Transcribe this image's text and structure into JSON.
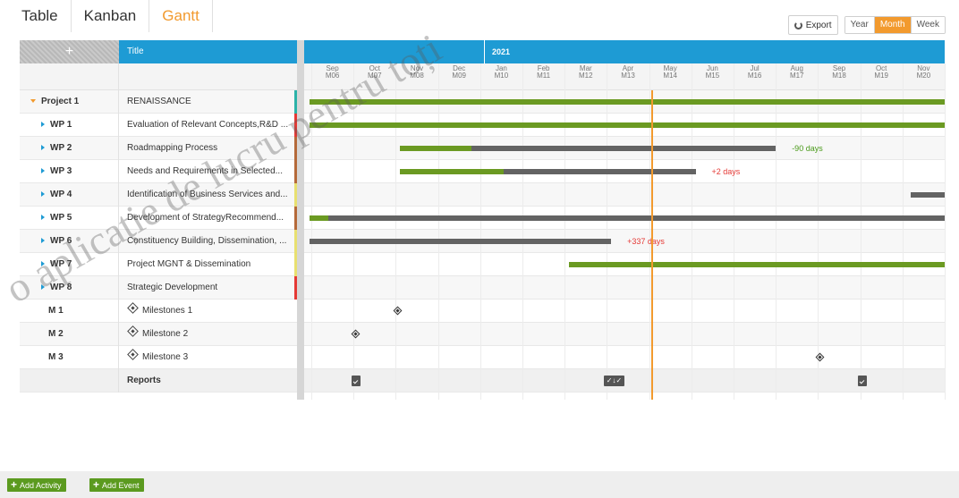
{
  "view_tabs": [
    {
      "label": "Table"
    },
    {
      "label": "Kanban"
    },
    {
      "label": "Gantt",
      "active": true
    }
  ],
  "toolbar": {
    "export_label": "Export",
    "zoom": [
      {
        "label": "Year"
      },
      {
        "label": "Month",
        "active": true
      },
      {
        "label": "Week"
      }
    ]
  },
  "header": {
    "add_symbol": "+",
    "title_label": "Title",
    "year_label": "2021",
    "months": [
      {
        "name": "Sep",
        "code": "M06"
      },
      {
        "name": "Oct",
        "code": "M07"
      },
      {
        "name": "Nov",
        "code": "M08"
      },
      {
        "name": "Dec",
        "code": "M09"
      },
      {
        "name": "Jan",
        "code": "M10"
      },
      {
        "name": "Feb",
        "code": "M11"
      },
      {
        "name": "Mar",
        "code": "M12"
      },
      {
        "name": "Apr",
        "code": "M13"
      },
      {
        "name": "May",
        "code": "M14"
      },
      {
        "name": "Jun",
        "code": "M15"
      },
      {
        "name": "Jul",
        "code": "M16"
      },
      {
        "name": "Aug",
        "code": "M17"
      },
      {
        "name": "Sep",
        "code": "M18"
      },
      {
        "name": "Oct",
        "code": "M19"
      },
      {
        "name": "Nov",
        "code": "M20"
      }
    ]
  },
  "rows": [
    {
      "id": "Project 1",
      "title": "RENAISSANCE",
      "kind": "project",
      "status_color": "#2bb3a8"
    },
    {
      "id": "WP 1",
      "title": "Evaluation of Relevant Concepts,R&D ...",
      "kind": "wp",
      "status_color": "#e53935"
    },
    {
      "id": "WP 2",
      "title": "Roadmapping Process",
      "kind": "wp",
      "status_color": "#b56a3a"
    },
    {
      "id": "WP 3",
      "title": "Needs and Requirements in Selected...",
      "kind": "wp",
      "status_color": "#b56a3a"
    },
    {
      "id": "WP 4",
      "title": "Identification of Business Services and...",
      "kind": "wp",
      "status_color": "#e8e070"
    },
    {
      "id": "WP 5",
      "title": "Development of StrategyRecommend...",
      "kind": "wp",
      "status_color": "#b56a3a"
    },
    {
      "id": "WP 6",
      "title": "Constituency Building, Dissemination, ...",
      "kind": "wp",
      "status_color": "#e8e070"
    },
    {
      "id": "WP 7",
      "title": "Project MGNT & Dissemination",
      "kind": "wp",
      "status_color": "#e8e070"
    },
    {
      "id": "WP 8",
      "title": "Strategic Development",
      "kind": "wp",
      "status_color": "#e53935"
    },
    {
      "id": "M 1",
      "title": "Milestones 1",
      "kind": "milestone"
    },
    {
      "id": "M 2",
      "title": "Milestone 2",
      "kind": "milestone"
    },
    {
      "id": "M 3",
      "title": "Milestone 3",
      "kind": "milestone"
    },
    {
      "id": "",
      "title": "Reports",
      "kind": "reports"
    }
  ],
  "gantt": {
    "colors": {
      "progress": "#6b9a22",
      "remaining": "#636363",
      "today": "#f29a2e",
      "ahead": "#4a9a1a",
      "late": "#e53935"
    },
    "bars": [
      {
        "row": 0,
        "start": -0.05,
        "end": 15.1,
        "progress": 1.0
      },
      {
        "row": 1,
        "start": -0.05,
        "end": 15.1,
        "progress": 1.0
      },
      {
        "row": 2,
        "start": 2.1,
        "end": 11.0,
        "progress": 0.19,
        "label": "-90 days",
        "label_type": "ahead"
      },
      {
        "row": 3,
        "start": 2.1,
        "end": 9.1,
        "progress": 0.35,
        "label": "+2 days",
        "label_type": "late"
      },
      {
        "row": 4,
        "start": 14.2,
        "end": 15.1,
        "progress": 0.0
      },
      {
        "row": 5,
        "start": -0.05,
        "end": 15.1,
        "progress": 0.03
      },
      {
        "row": 6,
        "start": -0.05,
        "end": 7.1,
        "progress": 0.0,
        "label": "+337 days",
        "label_type": "late"
      },
      {
        "row": 7,
        "start": 6.1,
        "end": 15.1,
        "progress": 1.0
      }
    ],
    "milestones": [
      {
        "row": 9,
        "at": 2.05
      },
      {
        "row": 10,
        "at": 1.05
      },
      {
        "row": 11,
        "at": 12.05
      }
    ],
    "reports": [
      {
        "row": 12,
        "at": 1.05,
        "kind": "single"
      },
      {
        "row": 12,
        "at": 7.05,
        "kind": "multi",
        "label": "✓↓✓"
      },
      {
        "row": 12,
        "at": 13.05,
        "kind": "single"
      }
    ],
    "today": 8.05
  },
  "footer": {
    "add_activity_label": "Add Activity",
    "add_event_label": "Add Event"
  },
  "watermark": {
    "text": "o aplicație de lucru pentru toți"
  }
}
